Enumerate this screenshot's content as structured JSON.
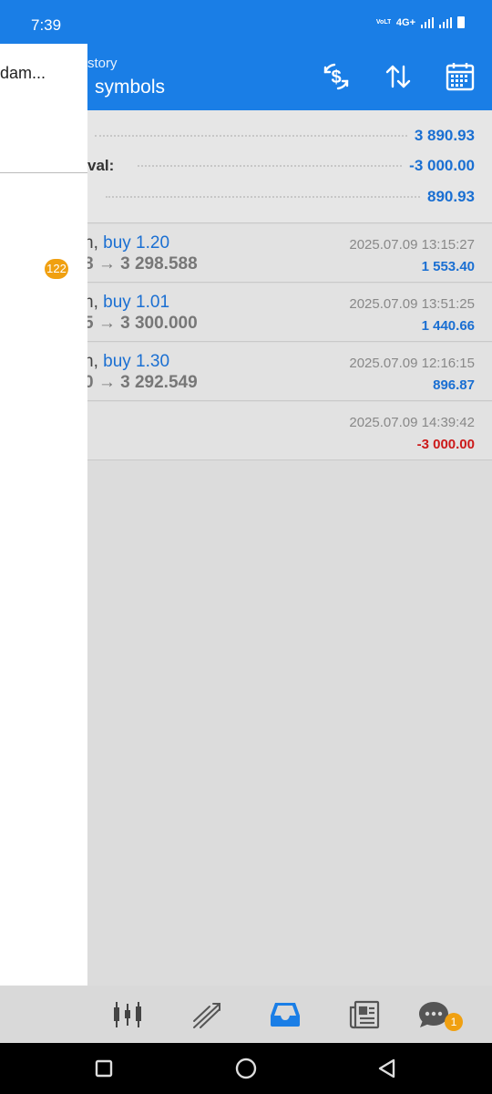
{
  "status_bar": {
    "time": "7:39",
    "network": "4G+",
    "volte": "VoLTE2"
  },
  "app_bar": {
    "subtitle": "story",
    "title": "symbols",
    "icons": [
      "currency-exchange-icon",
      "sort-icon",
      "calendar-icon"
    ]
  },
  "drawer": {
    "title": "dam...",
    "badge": "122"
  },
  "summary": {
    "rows": [
      {
        "label": "",
        "value": "3 890.93"
      },
      {
        "label": "val:",
        "value": "-3 000.00"
      },
      {
        "label": "",
        "value": "890.93"
      }
    ]
  },
  "trades": [
    {
      "prefix": "n, ",
      "action": "buy 1.20",
      "prices": "8 → 3 298.588",
      "date": "2025.07.09 13:15:27",
      "profit": "1 553.40"
    },
    {
      "prefix": "n, ",
      "action": "buy 1.01",
      "prices": "5 → 3 300.000",
      "date": "2025.07.09 13:51:25",
      "profit": "1 440.66"
    },
    {
      "prefix": "n, ",
      "action": "buy 1.30",
      "prices": "0 → 3 292.549",
      "date": "2025.07.09 12:16:15",
      "profit": "896.87"
    }
  ],
  "withdrawal": {
    "date": "2025.07.09 14:39:42",
    "amount": "-3 000.00"
  },
  "tab_bar": {
    "tabs": [
      "quotes-icon",
      "chart-icon",
      "history-icon",
      "news-icon",
      "chat-icon"
    ],
    "active": "history-icon",
    "chat_badge": "1"
  },
  "colors": {
    "primary": "#1a7ee6",
    "positive": "#1a6fd2",
    "negative": "#cc1a1a",
    "badge": "#f0a011"
  }
}
